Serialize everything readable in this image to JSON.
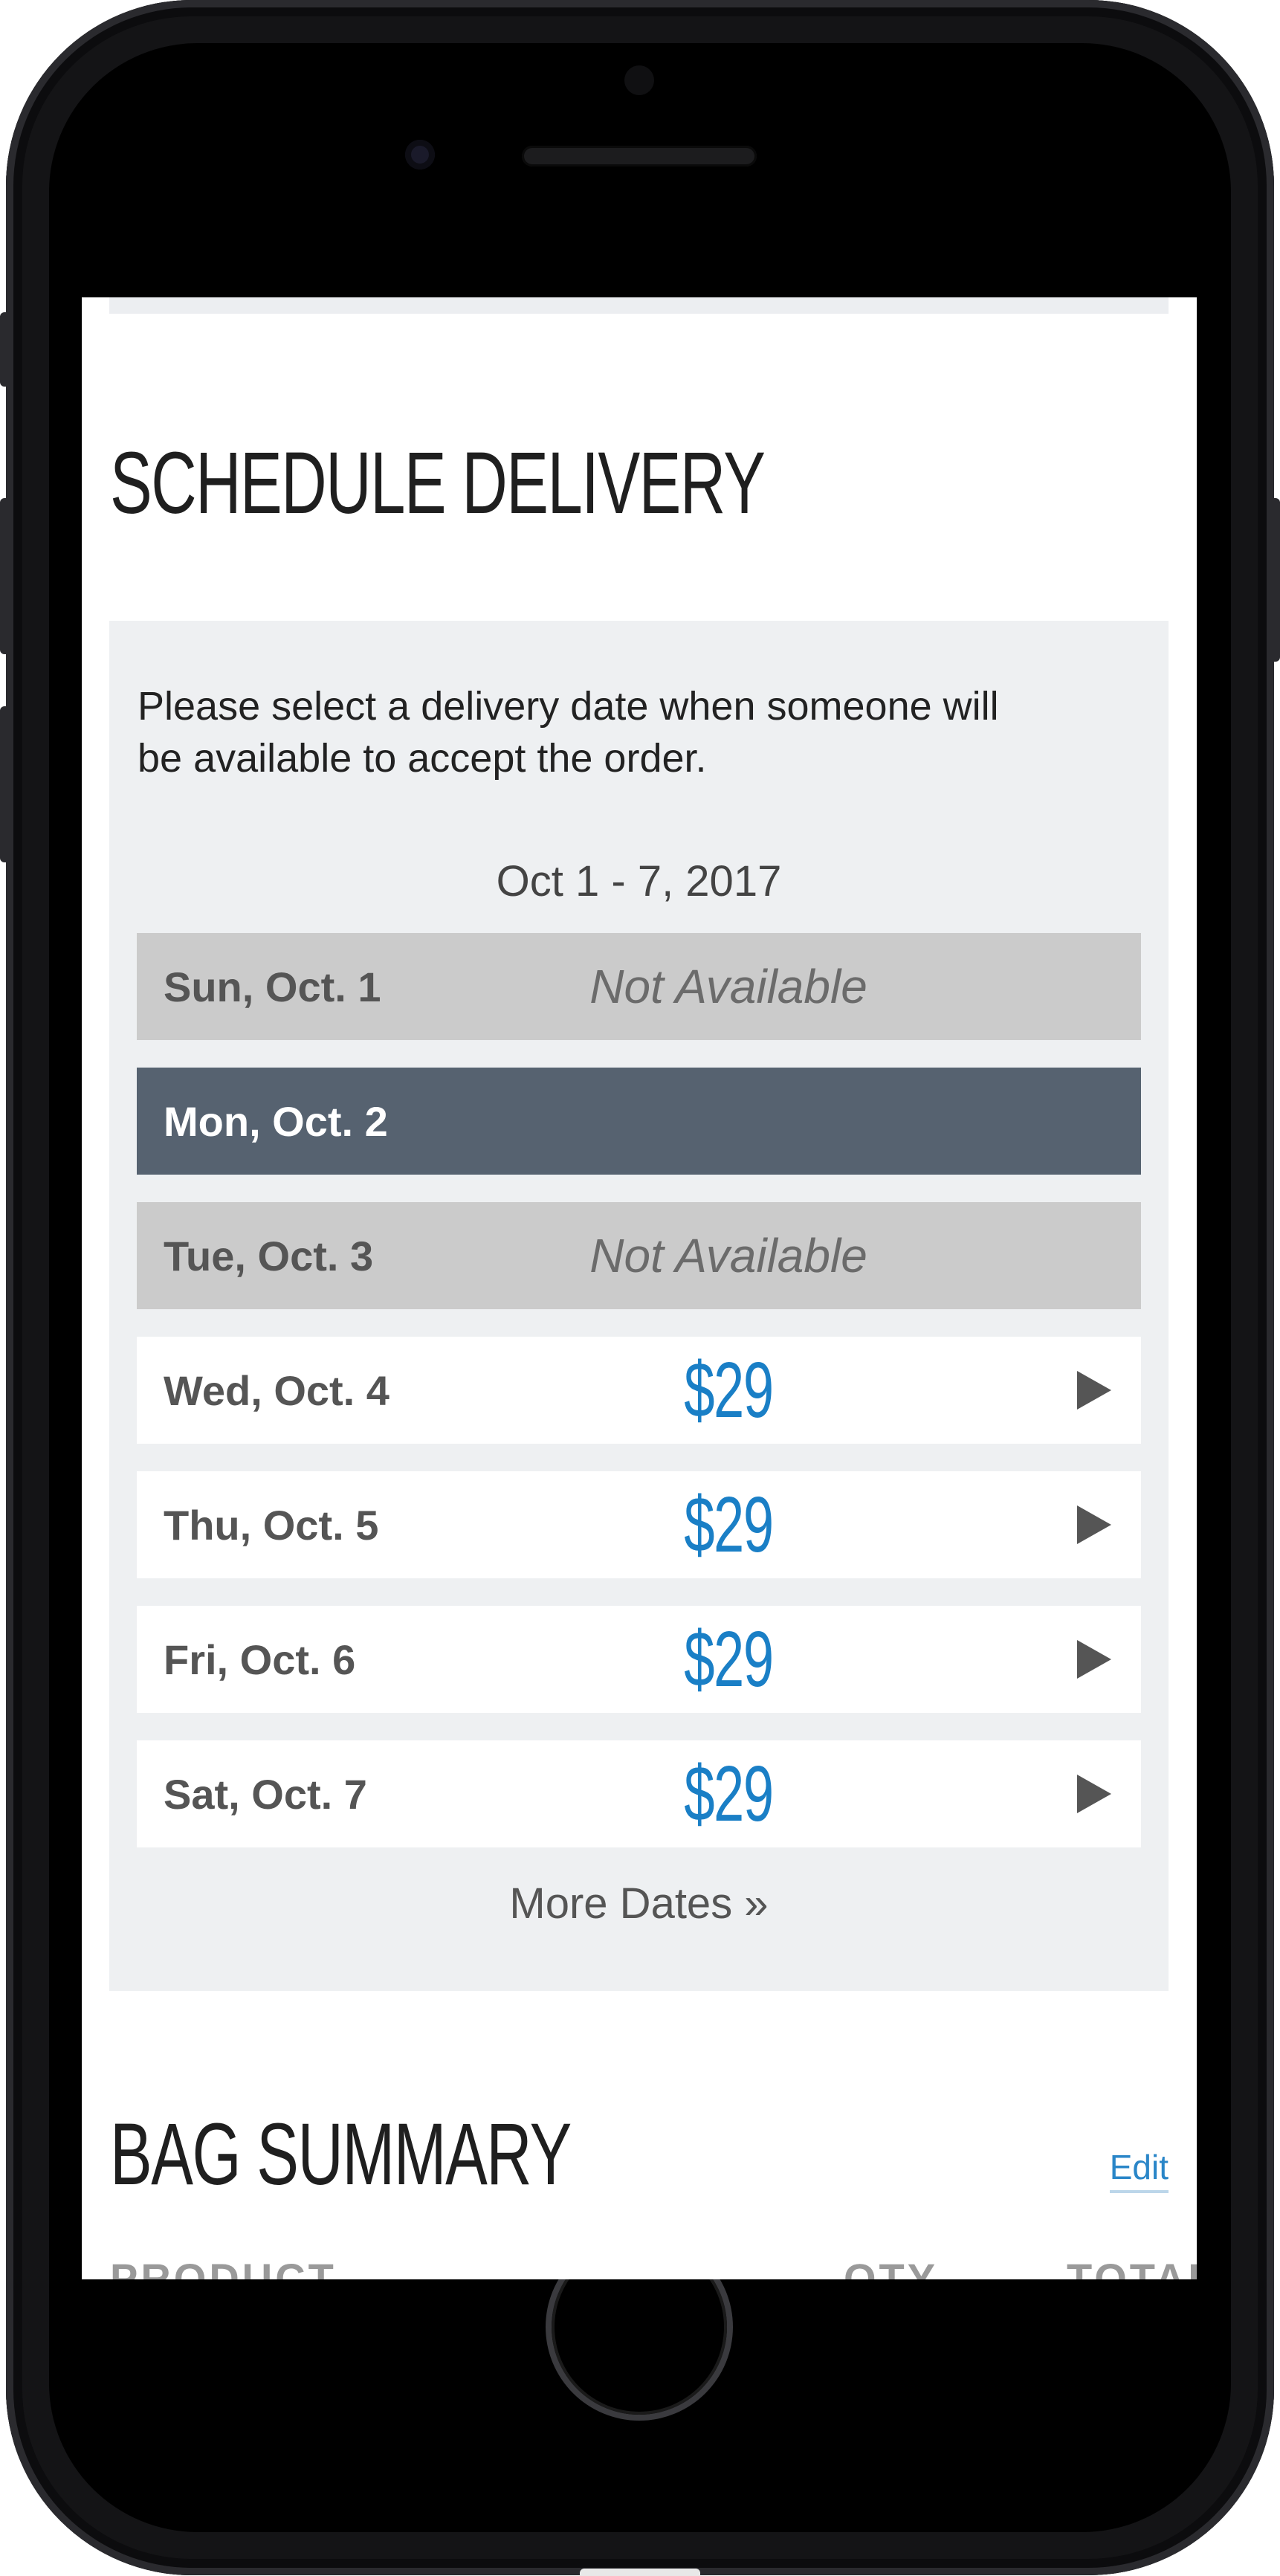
{
  "delivery": {
    "title": "SCHEDULE DELIVERY",
    "instructions": "Please select a delivery date when someone will be available to accept the order.",
    "week_label": "Oct 1 - 7, 2017",
    "days": [
      {
        "label": "Sun, Oct. 1",
        "status": "Not Available",
        "price": ""
      },
      {
        "label": "Mon, Oct. 2",
        "status": "",
        "price": ""
      },
      {
        "label": "Tue, Oct. 3",
        "status": "Not Available",
        "price": ""
      },
      {
        "label": "Wed, Oct. 4",
        "status": "",
        "price": "$29"
      },
      {
        "label": "Thu, Oct. 5",
        "status": "",
        "price": "$29"
      },
      {
        "label": "Fri, Oct. 6",
        "status": "",
        "price": "$29"
      },
      {
        "label": "Sat, Oct. 7",
        "status": "",
        "price": "$29"
      }
    ],
    "more_dates": "More Dates »"
  },
  "bag": {
    "title": "BAG SUMMARY",
    "edit_label": "Edit",
    "columns": [
      "PRODUCT",
      "QTY",
      "TOTAL"
    ]
  },
  "colors": {
    "selected_row": "#566270",
    "unavailable_row": "#cbcbcb",
    "price": "#1a7fc6",
    "panel_bg": "#eef0f2"
  }
}
